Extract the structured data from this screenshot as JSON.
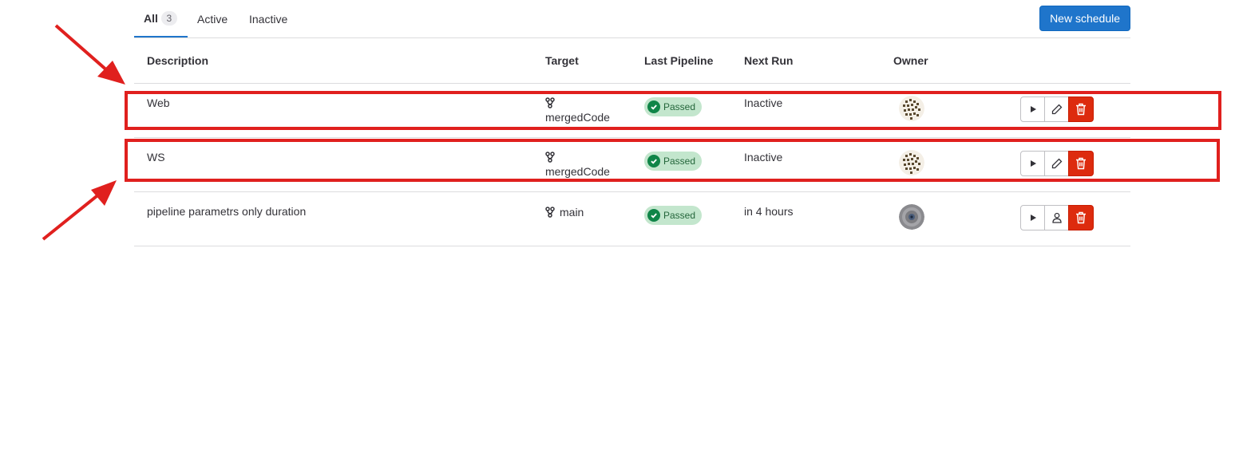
{
  "tabs": [
    {
      "label": "All",
      "count": "3"
    },
    {
      "label": "Active"
    },
    {
      "label": "Inactive"
    }
  ],
  "new_schedule_label": "New schedule",
  "columns": [
    "Description",
    "Target",
    "Last Pipeline",
    "Next Run",
    "Owner"
  ],
  "rows": [
    {
      "description": "Web",
      "target": "mergedCode",
      "status": "Passed",
      "next_run": "Inactive",
      "owner_avatar": "pattern-avatar",
      "secondary_action": "edit-icon"
    },
    {
      "description": "WS",
      "target": "mergedCode",
      "status": "Passed",
      "next_run": "Inactive",
      "owner_avatar": "pattern-avatar",
      "secondary_action": "edit-icon"
    },
    {
      "description": "pipeline parametrs only duration",
      "target": "main",
      "status": "Passed",
      "next_run": "in 4 hours",
      "owner_avatar": "circle-avatar",
      "secondary_action": "take-ownership-icon"
    }
  ],
  "colors": {
    "accent": "#1f75cb",
    "success": "#108548",
    "danger": "#dd2b0e",
    "annotation": "#e0201e"
  }
}
